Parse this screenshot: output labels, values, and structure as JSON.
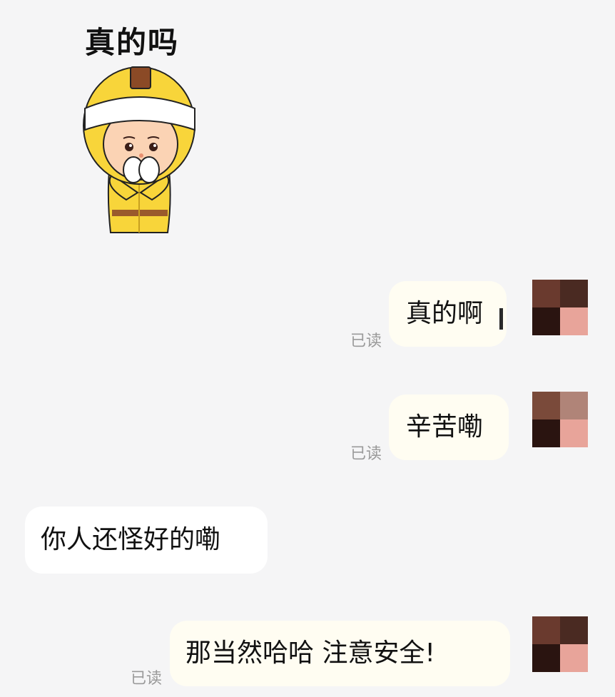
{
  "sticker": {
    "caption": "真的吗",
    "icon": "courier-worker-sticker"
  },
  "messages": [
    {
      "id": "m1",
      "direction": "outgoing",
      "text": "真的啊",
      "status": "已读"
    },
    {
      "id": "m2",
      "direction": "outgoing",
      "text": "辛苦嘞",
      "status": "已读"
    },
    {
      "id": "m3",
      "direction": "incoming",
      "text": "你人还怪好的嘞"
    },
    {
      "id": "m4",
      "direction": "outgoing",
      "text": "那当然哈哈 注意安全!",
      "status": "已读"
    }
  ],
  "colors": {
    "background": "#f5f5f6",
    "outgoing_bubble": "#fffdf2",
    "incoming_bubble": "#ffffff",
    "read_text": "#9a9a9a",
    "helmet_yellow": "#f8d53a",
    "helmet_brown": "#8b4a26"
  },
  "avatar_pixels": [
    "#6a3a2e",
    "#4a2a22",
    "#2a1410",
    "#e8a49a"
  ]
}
